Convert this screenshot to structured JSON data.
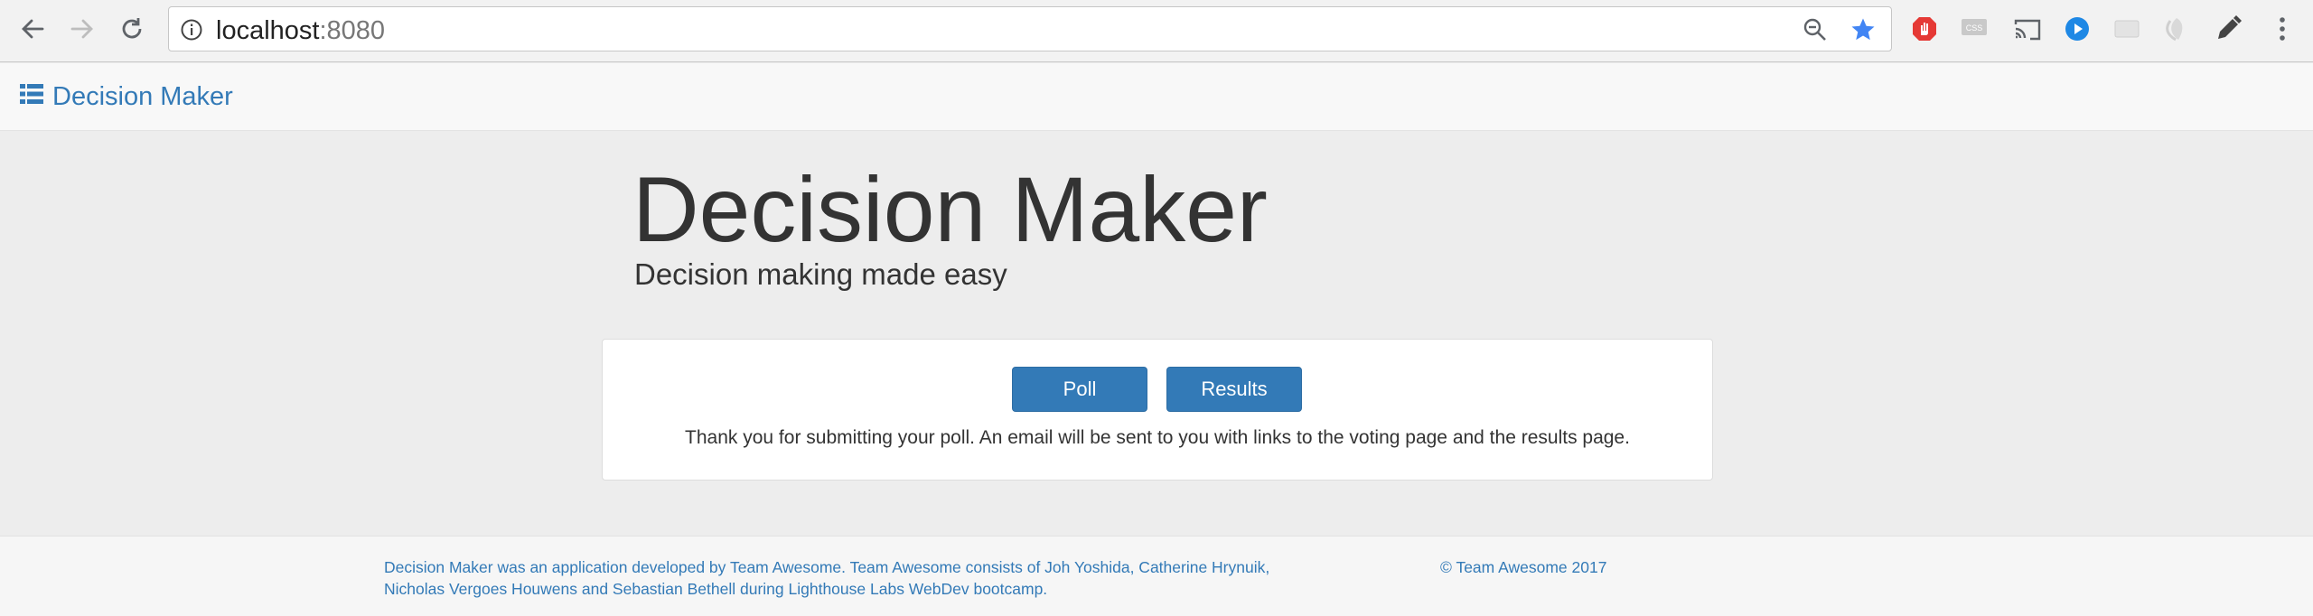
{
  "browser": {
    "url_host": "localhost",
    "url_port": ":8080"
  },
  "navbar": {
    "brand": "Decision Maker"
  },
  "jumbotron": {
    "title": "Decision Maker",
    "subtitle": "Decision making made easy"
  },
  "panel": {
    "poll_label": "Poll",
    "results_label": "Results",
    "message": "Thank you for submitting your poll. An email will be sent to you with links to the voting page and the results page."
  },
  "footer": {
    "about": "Decision Maker was an application developed by Team Awesome. Team Awesome consists of Joh Yoshida, Catherine Hrynuik, Nicholas Vergoes Houwens and Sebastian Bethell during Lighthouse Labs WebDev bootcamp.",
    "copyright": "© Team Awesome 2017"
  },
  "colors": {
    "accent": "#337ab7",
    "page_bg": "#ededed"
  },
  "icons": {
    "back": "arrow-left-icon",
    "forward": "arrow-right-icon",
    "reload": "reload-icon",
    "info": "info-icon",
    "zoom": "zoom-out-icon",
    "bookmark": "star-icon",
    "brand": "list-icon",
    "menu": "kebab-menu-icon"
  }
}
